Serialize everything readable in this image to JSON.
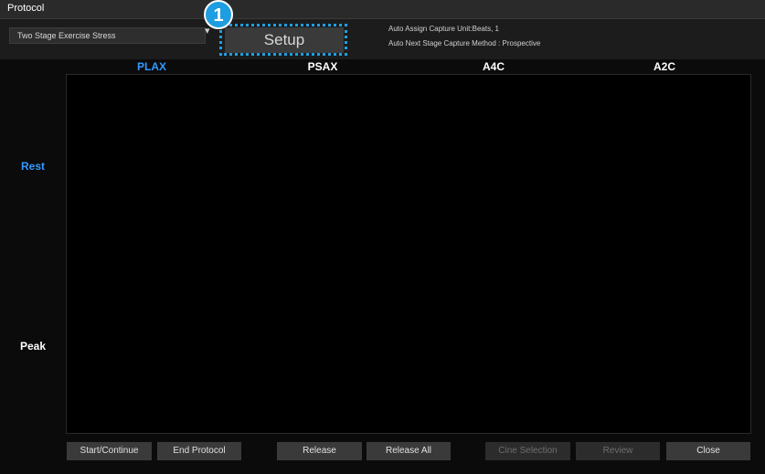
{
  "window": {
    "title": "Protocol"
  },
  "protocol_select": {
    "value": "Two Stage Exercise Stress"
  },
  "setup_button": {
    "label": "Setup"
  },
  "callout": {
    "number": "1",
    "color": "#1e9ee0"
  },
  "info": {
    "line1": "Auto Assign Capture Unit:Beats, 1",
    "line2": "Auto Next Stage Capture Method : Prospective"
  },
  "columns": [
    "PLAX",
    "PSAX",
    "A4C",
    "A2C"
  ],
  "rows": [
    "Rest",
    "Peak"
  ],
  "buttons": {
    "start": "Start/Continue",
    "end": "End Protocol",
    "release": "Release",
    "release_all": "Release All",
    "cine_selection": "Cine Selection",
    "review": "Review",
    "close": "Close"
  },
  "colors": {
    "active": "#3399ff",
    "background": "#0b0b0b"
  }
}
